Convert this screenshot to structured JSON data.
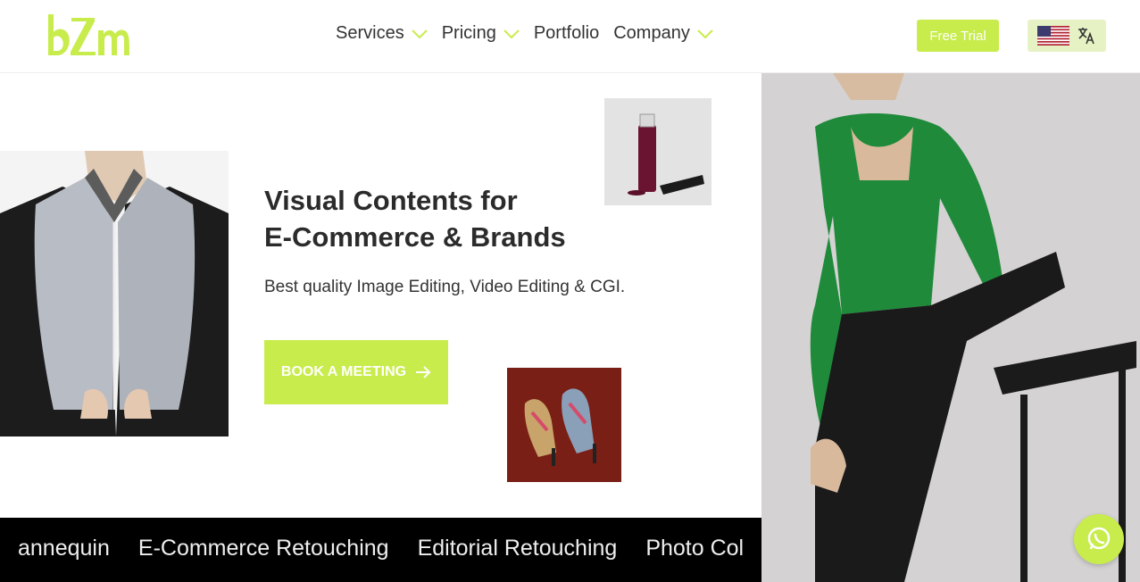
{
  "brand": {
    "logo_text": "bZm",
    "accent_color": "#c8ec4c"
  },
  "nav": {
    "items": [
      {
        "label": "Services",
        "has_dropdown": true
      },
      {
        "label": "Pricing",
        "has_dropdown": true
      },
      {
        "label": "Portfolio",
        "has_dropdown": false
      },
      {
        "label": "Company",
        "has_dropdown": true
      }
    ]
  },
  "header": {
    "free_trial_label": "Free Trial",
    "language_icon": "us-flag-icon",
    "translate_icon": "translate-icon"
  },
  "hero": {
    "title_line1": "Visual Contents for",
    "title_line2": "E-Commerce & Brands",
    "subtitle": "Best quality Image Editing, Video Editing & CGI.",
    "cta_label": "BOOK A MEETING",
    "cta_icon": "arrow-right-icon"
  },
  "marquee": {
    "items": [
      "annequin",
      "E-Commerce Retouching",
      "Editorial Retouching",
      "Photo Col"
    ]
  },
  "chat": {
    "icon": "whatsapp-icon"
  }
}
